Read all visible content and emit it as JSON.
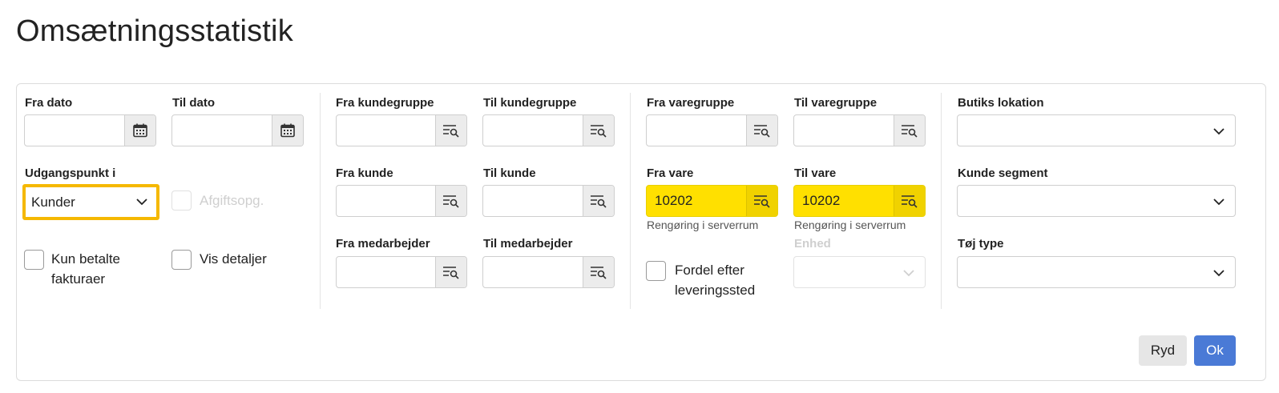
{
  "page": {
    "title": "Omsætningsstatistik"
  },
  "dates": {
    "from_label": "Fra dato",
    "from_value": "",
    "to_label": "Til dato",
    "to_value": ""
  },
  "basis": {
    "label": "Udgangspunkt i",
    "selected": "Kunder",
    "afgift_label": "Afgiftsopg."
  },
  "checkboxes": {
    "paid_only": "Kun betalte fakturaer",
    "show_details": "Vis detaljer",
    "distribute": "Fordel efter leveringssted"
  },
  "customer_groups": {
    "from_label": "Fra kundegruppe",
    "from_value": "",
    "to_label": "Til kundegruppe",
    "to_value": ""
  },
  "customers": {
    "from_label": "Fra kunde",
    "from_value": "",
    "to_label": "Til kunde",
    "to_value": ""
  },
  "employees": {
    "from_label": "Fra medarbejder",
    "from_value": "",
    "to_label": "Til medarbejder",
    "to_value": ""
  },
  "item_groups": {
    "from_label": "Fra varegruppe",
    "from_value": "",
    "to_label": "Til varegruppe",
    "to_value": ""
  },
  "items": {
    "from_label": "Fra vare",
    "from_value": "10202",
    "from_desc": "Rengøring i serverrum",
    "to_label": "Til vare",
    "to_value": "10202",
    "to_desc": "Rengøring i serverrum"
  },
  "unit": {
    "label": "Enhed",
    "value": ""
  },
  "store_location": {
    "label": "Butiks lokation",
    "value": ""
  },
  "customer_segment": {
    "label": "Kunde segment",
    "value": ""
  },
  "clothing_type": {
    "label": "Tøj type",
    "value": ""
  },
  "buttons": {
    "clear": "Ryd",
    "ok": "Ok"
  },
  "icons": {
    "calendar": "calendar-icon",
    "lookup": "list-search-icon",
    "dropdown": "chevron-down-icon"
  },
  "colors": {
    "highlight_field": "#ffe000",
    "focus_border": "#f5b800",
    "primary_button": "#4a7ad6"
  }
}
